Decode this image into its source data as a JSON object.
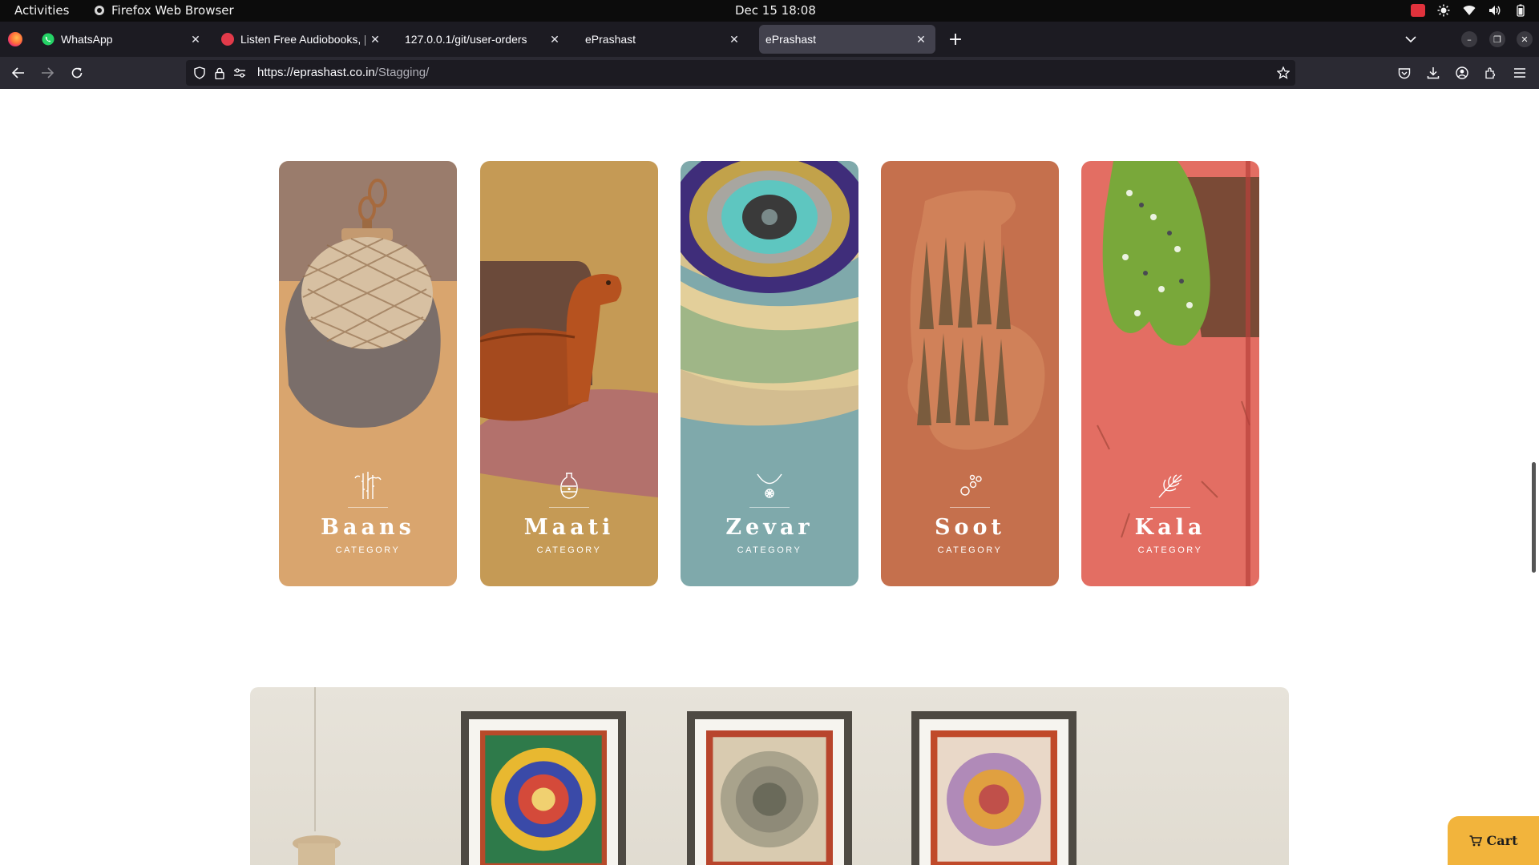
{
  "system_bar": {
    "activities": "Activities",
    "app_name": "Firefox Web Browser",
    "clock": "Dec 15  18:08"
  },
  "tabs": [
    {
      "title": "WhatsApp",
      "favicon": "whatsapp-icon",
      "color": "#25d366"
    },
    {
      "title": "Listen Free Audiobooks, |",
      "favicon": "audiobooks-icon",
      "color": "#e23a4a"
    },
    {
      "title": "127.0.0.1/git/user-orders",
      "favicon": "",
      "color": ""
    },
    {
      "title": "ePrashast",
      "favicon": "",
      "color": ""
    },
    {
      "title": "ePrashast",
      "favicon": "",
      "color": "",
      "active": true
    }
  ],
  "address_bar": {
    "url_domain": "https://eprashast.co.in",
    "url_path": "/Stagging/"
  },
  "categories": [
    {
      "name": "Baans",
      "tag": "CATEGORY",
      "bg": "#d9a56e",
      "icon": "bamboo-icon"
    },
    {
      "name": "Maati",
      "tag": "CATEGORY",
      "bg": "#c59a55",
      "icon": "pot-icon"
    },
    {
      "name": "Zevar",
      "tag": "CATEGORY",
      "bg": "#7fa9ab",
      "icon": "necklace-icon"
    },
    {
      "name": "Soot",
      "tag": "CATEGORY",
      "bg": "#c5704d",
      "icon": "thread-icon"
    },
    {
      "name": "Kala",
      "tag": "CATEGORY",
      "bg": "#e36e63",
      "icon": "brush-leaf-icon"
    }
  ],
  "cart": {
    "label": "Cart",
    "icon": "cart-icon",
    "color": "#f2b43c"
  }
}
